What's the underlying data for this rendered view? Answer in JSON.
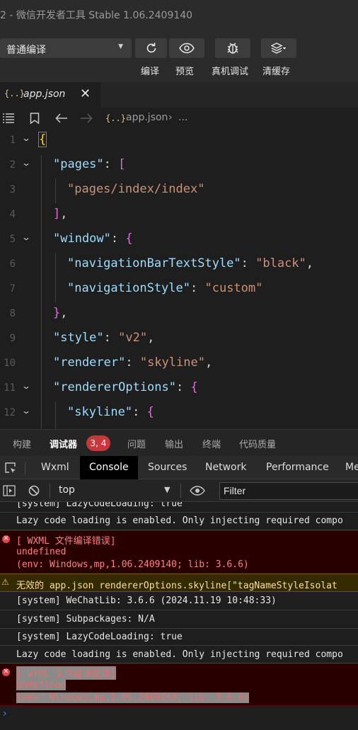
{
  "titlebar": {
    "title": "2 - 微信开发者工具 Stable 1.06.2409140"
  },
  "toolbar": {
    "compile_mode": "普通编译",
    "compile_label": "编译",
    "preview_label": "预览",
    "remote_debug_label": "真机调试",
    "clear_cache_label": "清缓存",
    "icons": [
      "refresh-icon",
      "eye-icon",
      "bug-icon",
      "layers-icon"
    ]
  },
  "editor_tab": {
    "icon": "{..}",
    "filename": "app.json",
    "close": "✕"
  },
  "breadcrumb": {
    "icon": "{..}",
    "file": "app.json",
    "separator": "›",
    "more": "..."
  },
  "code": {
    "line_numbers": [
      "1",
      "2",
      "3",
      "4",
      "5",
      "6",
      "7",
      "8",
      "9",
      "10",
      "11",
      "12"
    ],
    "lines": {
      "l1_open": "{",
      "l2_key": "\"pages\"",
      "l2_colon": ": ",
      "l2_bracket": "[",
      "l3_val": "\"pages/index/index\"",
      "l4_bracket": "]",
      "l4_comma": ",",
      "l5_key": "\"window\"",
      "l5_colon": ": ",
      "l5_brace": "{",
      "l6_key": "\"navigationBarTextStyle\"",
      "l6_colon": ": ",
      "l6_val": "\"black\"",
      "l6_comma": ",",
      "l7_key": "\"navigationStyle\"",
      "l7_colon": ": ",
      "l7_val": "\"custom\"",
      "l8_brace": "}",
      "l8_comma": ",",
      "l9_key": "\"style\"",
      "l9_colon": ": ",
      "l9_val": "\"v2\"",
      "l9_comma": ",",
      "l10_key": "\"renderer\"",
      "l10_colon": ": ",
      "l10_val": "\"skyline\"",
      "l10_comma": ",",
      "l11_key": "\"rendererOptions\"",
      "l11_colon": ": ",
      "l11_brace": "{",
      "l12_key": "\"skyline\"",
      "l12_colon": ": ",
      "l12_brace": "{"
    }
  },
  "panel_tabs": {
    "build": "构建",
    "debugger": "调试器",
    "badge": "3, 4",
    "issues": "问题",
    "output": "输出",
    "terminal": "终端",
    "code_quality": "代码质量"
  },
  "devtools_tabs": {
    "wxml": "Wxml",
    "console": "Console",
    "sources": "Sources",
    "network": "Network",
    "performance": "Performance",
    "more": "Me"
  },
  "console_toolbar": {
    "context": "top",
    "filter_placeholder": "Filter"
  },
  "console": {
    "m0": "[system] LazyCodeLoading: true",
    "m1": "Lazy code loading is enabled. Only injecting required compo",
    "m2_title": "[ WXML 文件编译错误]",
    "m2_undef": "undefined",
    "m2_env": "(env: Windows,mp,1.06.2409140; lib: 3.6.6)",
    "m3": "无效的 app.json rendererOptions.skyline[\"tagNameStyleIsolat",
    "m4": "[system] WeChatLib: 3.6.6 (2024.11.19 10:48:33)",
    "m5": "[system] Subpackages: N/A",
    "m6": "[system] LazyCodeLoading: true",
    "m7": "Lazy code loading is enabled. Only injecting required compo",
    "m8_title": "[ WXML 文件编译错误]",
    "m8_undef": "undefined",
    "m8_env": "(env: Windows,mp,1.06.2409140; lib: 3.6.6)",
    "prompt": "›"
  }
}
